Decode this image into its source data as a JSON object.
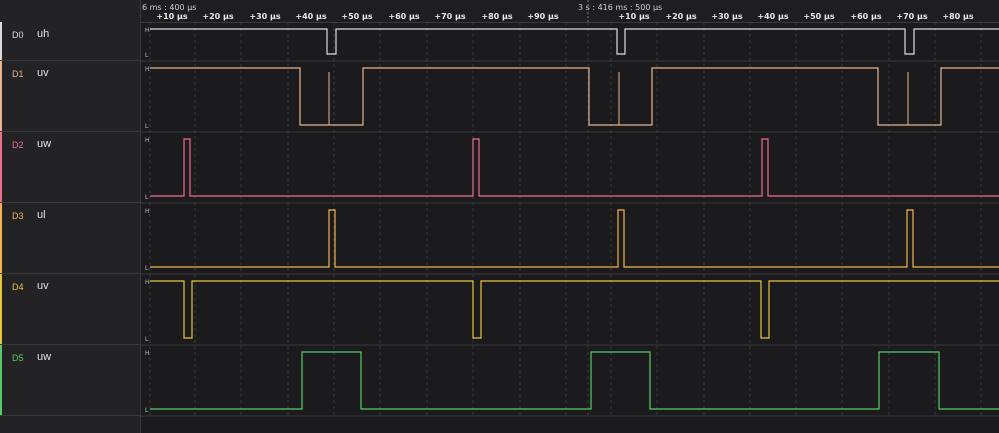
{
  "ruler": {
    "left_label": "6 ms : 400 µs",
    "center_label": "3 s : 416 ms : 500 µs",
    "ticks": [
      "+10 µs",
      "+20 µs",
      "+30 µs",
      "+40 µs",
      "+50 µs",
      "+60 µs",
      "+70 µs",
      "+80 µs",
      "+90 µs",
      "+10 µs",
      "+20 µs",
      "+30 µs",
      "+40 µs",
      "+50 µs",
      "+60 µs",
      "+70 µs",
      "+80 µs"
    ]
  },
  "level_labels": {
    "high": "H",
    "low": "L"
  },
  "channels": [
    {
      "id": "D0",
      "name": "uh",
      "color": "#dcdcdc"
    },
    {
      "id": "D1",
      "name": "uv",
      "color": "#e9b48c"
    },
    {
      "id": "D2",
      "name": "uw",
      "color": "#ee6f8b"
    },
    {
      "id": "D3",
      "name": "ul",
      "color": "#f3b34f"
    },
    {
      "id": "D4",
      "name": "uv",
      "color": "#e7c63a"
    },
    {
      "id": "D5",
      "name": "uw",
      "color": "#55cc65"
    }
  ]
}
